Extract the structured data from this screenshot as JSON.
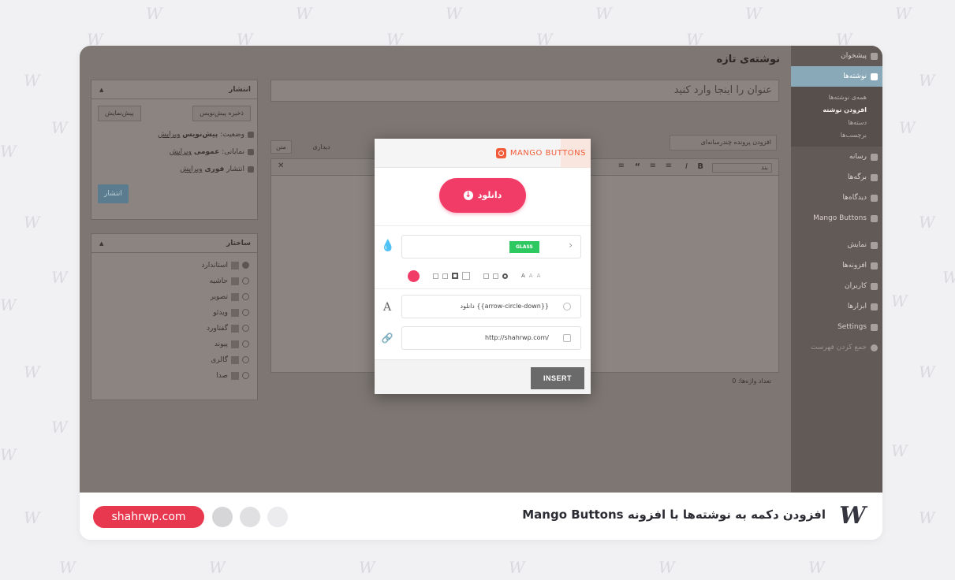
{
  "caption": {
    "title": "افزودن دکمه به نوشته‌ها با افزونه Mango Buttons",
    "site": "shahrwp.com"
  },
  "wp_sidebar": {
    "items": [
      {
        "label": "پیشخوان",
        "icon": "dashboard-icon",
        "active": false
      },
      {
        "label": "نوشته‌ها",
        "icon": "pin-icon",
        "active": true
      }
    ],
    "submenu": [
      {
        "label": "همه‌ی نوشته‌ها",
        "current": false
      },
      {
        "label": "افزودن نوشته",
        "current": true
      },
      {
        "label": "دسته‌ها",
        "current": false
      },
      {
        "label": "برچسب‌ها",
        "current": false
      }
    ],
    "items_after": [
      {
        "label": "رسانه",
        "icon": "media-icon"
      },
      {
        "label": "برگه‌ها",
        "icon": "pages-icon"
      },
      {
        "label": "دیدگاه‌ها",
        "icon": "comments-icon"
      },
      {
        "label": "Mango Buttons",
        "icon": "mango-icon"
      },
      {
        "label": "نمایش",
        "icon": "appearance-icon"
      },
      {
        "label": "افزونه‌ها",
        "icon": "plugins-icon"
      },
      {
        "label": "کاربران",
        "icon": "users-icon"
      },
      {
        "label": "ابزارها",
        "icon": "tools-icon"
      },
      {
        "label": "Settings",
        "icon": "settings-icon"
      },
      {
        "label": "جمع کردن فهرست",
        "icon": "collapse-icon"
      }
    ]
  },
  "editor": {
    "page_title": "نوشته‌ی تازه",
    "title_placeholder": "عنوان را اینجا وارد کنید",
    "add_media": "افزودن پرونده چندرسانه‌ای",
    "tab_visual": "دیداری",
    "tab_text": "متن",
    "paragraph": "بند",
    "word_count": "تعداد واژه‌ها: 0"
  },
  "publish_box": {
    "title": "انتشار",
    "save_draft": "ذخیره پیش‌نویس",
    "preview": "پیش‌نمایش",
    "status_prefix": "وضعیت:",
    "status_value": "پیش‌نویس",
    "visibility_prefix": "نمایانی:",
    "visibility_value": "عمومی",
    "publish_prefix": "انتشار",
    "publish_value": "فوری",
    "edit": "ویرایش",
    "publish_button": "انتشار"
  },
  "format_box": {
    "title": "ساختار",
    "options": [
      "استاندارد",
      "حاشیه",
      "تصویر",
      "ویدئو",
      "گفتاورد",
      "پیوند",
      "گالری",
      "صدا"
    ]
  },
  "modal": {
    "brand": "MANGO BUTTONS",
    "preview_label": "دانلود",
    "style_badge": "GLASS",
    "text_value": "دانلود {{arrow-circle-down}}",
    "link_value": "http://shahrwp.com/",
    "insert_label": "INSERT",
    "colors": {
      "accent": "#f03c66",
      "glass": "#2dc85f",
      "brand": "#f25b3a"
    },
    "size_letters": [
      "A",
      "A",
      "A"
    ]
  },
  "colors": {
    "site_badge": "#e8384f",
    "dot1": "#d6d6d9",
    "dot2": "#e0e0e3",
    "dot3": "#ececee"
  }
}
